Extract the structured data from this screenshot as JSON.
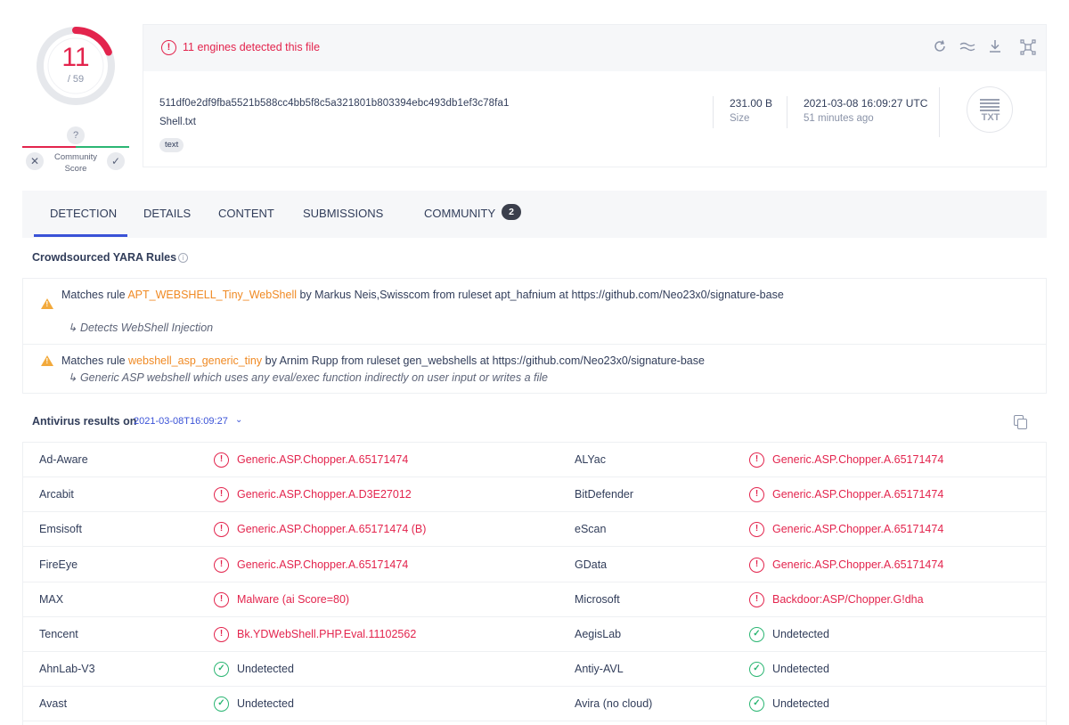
{
  "score": {
    "detections": "11",
    "total": "/ 59",
    "detected_fraction": 0.1864
  },
  "community": {
    "question": "?",
    "label_line1": "Community",
    "label_line2": "Score",
    "downvote": "✕",
    "upvote": "✓"
  },
  "summary": {
    "alert": "11 engines detected this file",
    "hash": "511df0e2df9fba5521b588cc4bb5f8c5a321801b803394ebc493db1ef3c78fa1",
    "filename": "Shell.txt",
    "tag": "text",
    "size_value": "231.00 B",
    "size_label": "Size",
    "date_value": "2021-03-08 16:09:27 UTC",
    "date_ago": "51 minutes ago",
    "filetype": "TXT"
  },
  "tabs": {
    "detection": "DETECTION",
    "details": "DETAILS",
    "content": "CONTENT",
    "submissions": "SUBMISSIONS",
    "community": "COMMUNITY",
    "community_count": "2"
  },
  "yara": {
    "heading": "Crowdsourced YARA Rules",
    "rules": [
      {
        "prefix": "Matches rule ",
        "name": "APT_WEBSHELL_Tiny_WebShell",
        "suffix": " by Markus Neis,Swisscom from ruleset apt_hafnium at https://github.com/Neo23x0/signature-base",
        "description": "Detects WebShell Injection"
      },
      {
        "prefix": "Matches rule ",
        "name": "webshell_asp_generic_tiny",
        "suffix": " by Arnim Rupp from ruleset gen_webshells at https://github.com/Neo23x0/signature-base",
        "description": "Generic ASP webshell which uses any eval/exec function indirectly on user input or writes a file"
      }
    ]
  },
  "av": {
    "heading": "Antivirus results on",
    "date": "2021-03-08T16:09:27",
    "rows": [
      {
        "left_engine": "Ad-Aware",
        "left_result": "Generic.ASP.Chopper.A.65171474",
        "right_engine": "ALYac",
        "right_result": "Generic.ASP.Chopper.A.65171474"
      },
      {
        "left_engine": "Arcabit",
        "left_result": "Generic.ASP.Chopper.A.D3E27012",
        "right_engine": "BitDefender",
        "right_result": "Generic.ASP.Chopper.A.65171474"
      },
      {
        "left_engine": "Emsisoft",
        "left_result": "Generic.ASP.Chopper.A.65171474 (B)",
        "right_engine": "eScan",
        "right_result": "Generic.ASP.Chopper.A.65171474"
      },
      {
        "left_engine": "FireEye",
        "left_result": "Generic.ASP.Chopper.A.65171474",
        "right_engine": "GData",
        "right_result": "Generic.ASP.Chopper.A.65171474"
      },
      {
        "left_engine": "MAX",
        "left_result": "Malware (ai Score=80)",
        "right_engine": "Microsoft",
        "right_result": "Backdoor:ASP/Chopper.G!dha"
      },
      {
        "left_engine": "Tencent",
        "left_result": "Bk.YDWebShell.PHP.Eval.11102562",
        "right_engine": "AegisLab",
        "right_result": "Undetected"
      },
      {
        "left_engine": "AhnLab-V3",
        "left_result": "Undetected",
        "right_engine": "Antiy-AVL",
        "right_result": "Undetected"
      },
      {
        "left_engine": "Avast",
        "left_result": "Undetected",
        "right_engine": "Avira (no cloud)",
        "right_result": "Undetected"
      }
    ]
  },
  "colors": {
    "malicious": "#e3244d",
    "clean": "#2bb673",
    "accent": "#3a52d7",
    "yara_rule": "#f08a24"
  }
}
